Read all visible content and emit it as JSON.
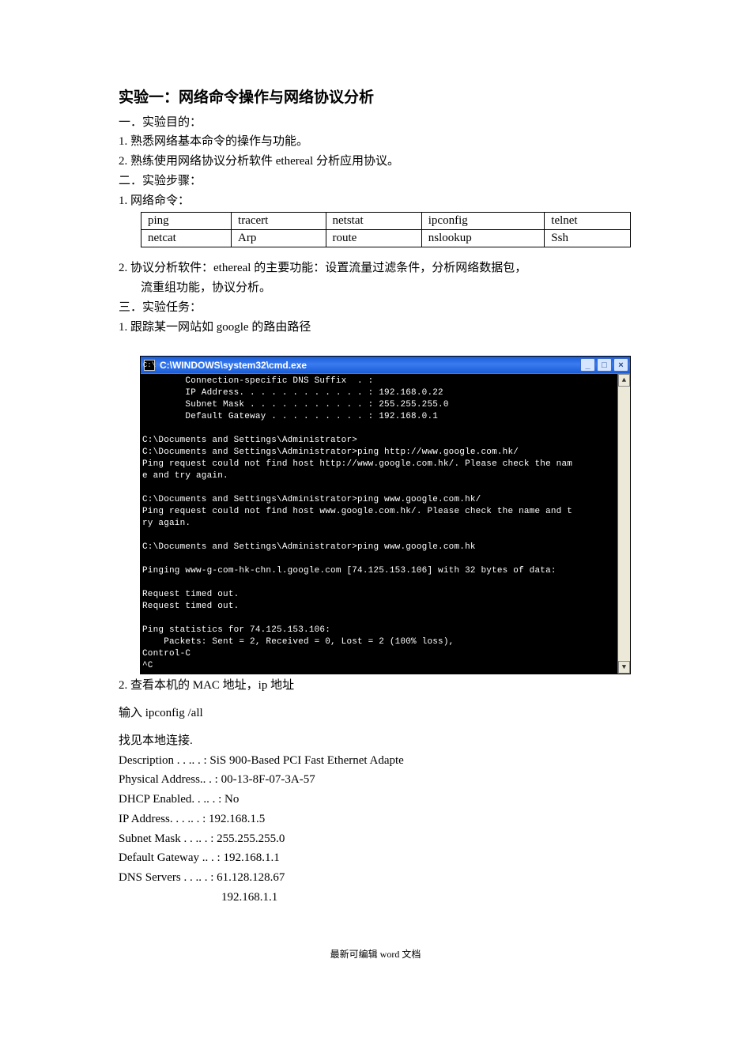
{
  "title": "实验一：网络命令操作与网络协议分析",
  "sec1_heading": "一．实验目的：",
  "sec1_item1": "1.    熟悉网络基本命令的操作与功能。",
  "sec1_item2": "2.    熟练使用网络协议分析软件 ethereal 分析应用协议。",
  "sec2_heading": "二．实验步骤：",
  "sec2_item1": "1.    网络命令：",
  "cmd_table": {
    "rows": [
      [
        "ping",
        "tracert",
        "netstat",
        "ipconfig",
        "telnet"
      ],
      [
        "netcat",
        "Arp",
        "route",
        "nslookup",
        "Ssh"
      ]
    ]
  },
  "sec2_item2_a": "2.    协议分析软件：ethereal 的主要功能：设置流量过滤条件，分析网络数据包，",
  "sec2_item2_b": "流重组功能，协议分析。",
  "sec3_heading": "三．实验任务：",
  "sec3_task1": "1.    跟踪某一网站如 google 的路由路径",
  "cmdwin": {
    "title": "C:\\WINDOWS\\system32\\cmd.exe",
    "icon_label": "C:\\",
    "min_label": "_",
    "max_label": "□",
    "close_label": "×",
    "up_label": "▲",
    "down_label": "▼",
    "body": "        Connection-specific DNS Suffix  . :\n        IP Address. . . . . . . . . . . . : 192.168.0.22\n        Subnet Mask . . . . . . . . . . . : 255.255.255.0\n        Default Gateway . . . . . . . . . : 192.168.0.1\n\nC:\\Documents and Settings\\Administrator>\nC:\\Documents and Settings\\Administrator>ping http://www.google.com.hk/\nPing request could not find host http://www.google.com.hk/. Please check the nam\ne and try again.\n\nC:\\Documents and Settings\\Administrator>ping www.google.com.hk/\nPing request could not find host www.google.com.hk/. Please check the name and t\nry again.\n\nC:\\Documents and Settings\\Administrator>ping www.google.com.hk\n\nPinging www-g-com-hk-chn.l.google.com [74.125.153.106] with 32 bytes of data:\n\nRequest timed out.\nRequest timed out.\n\nPing statistics for 74.125.153.106:\n    Packets: Sent = 2, Received = 0, Lost = 2 (100% loss),\nControl-C\n^C"
  },
  "sec3_task2": "2.    查看本机的 MAC 地址，ip 地址",
  "task2_cmd": "输入 ipconfig /all",
  "task2_find": "找见本地连接.",
  "ipconfig": {
    "description": "Description . . .. . : SiS 900-Based PCI Fast Ethernet Adapte",
    "physical": "Physical Address.. . : 00-13-8F-07-3A-57",
    "dhcp": "DHCP Enabled. . .. . : No",
    "ip": "IP Address. . . .. . : 192.168.1.5",
    "subnet": "Subnet Mask . . .. . : 255.255.255.0",
    "gateway": "Default Gateway .. . : 192.168.1.1",
    "dns1": "DNS Servers . . .. . : 61.128.128.67",
    "dns2": "192.168.1.1"
  },
  "footer_a": "最新可编辑 ",
  "footer_b": "word ",
  "footer_c": "文档"
}
